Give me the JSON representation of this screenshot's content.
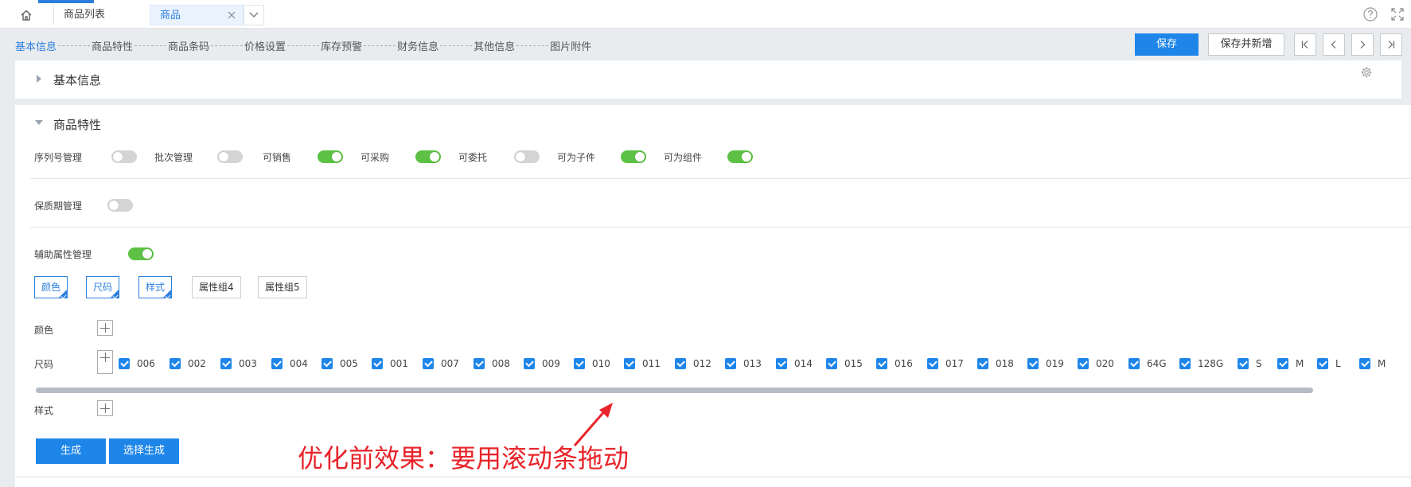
{
  "tabs": {
    "list_label": "商品列表",
    "active_label": "商品"
  },
  "steps": [
    "基本信息",
    "商品特性",
    "商品条码",
    "价格设置",
    "库存预警",
    "财务信息",
    "其他信息",
    "图片附件"
  ],
  "toolbar": {
    "save_label": "保存",
    "save_new_label": "保存并新增"
  },
  "sections": {
    "basic_title": "基本信息",
    "prop_title": "商品特性"
  },
  "switches": [
    {
      "label": "序列号管理",
      "on": false
    },
    {
      "label": "批次管理",
      "on": false
    },
    {
      "label": "可销售",
      "on": true
    },
    {
      "label": "可采购",
      "on": true
    },
    {
      "label": "可委托",
      "on": false
    },
    {
      "label": "可为子件",
      "on": true
    },
    {
      "label": "可为组件",
      "on": true
    }
  ],
  "shelf_life": {
    "label": "保质期管理",
    "on": false
  },
  "aux_attr": {
    "label": "辅助属性管理",
    "on": true
  },
  "attr_groups": [
    {
      "label": "颜色",
      "selected": true
    },
    {
      "label": "尺码",
      "selected": true
    },
    {
      "label": "样式",
      "selected": true
    },
    {
      "label": "属性组4",
      "selected": false
    },
    {
      "label": "属性组5",
      "selected": false
    }
  ],
  "attr_rows": {
    "color_label": "颜色",
    "size_label": "尺码",
    "style_label": "样式"
  },
  "size_values": [
    "006",
    "002",
    "003",
    "004",
    "005",
    "001",
    "007",
    "008",
    "009",
    "010",
    "011",
    "012",
    "013",
    "014",
    "015",
    "016",
    "017",
    "018",
    "019",
    "020",
    "64G",
    "128G",
    "S",
    "M",
    "L",
    "M"
  ],
  "actions": {
    "generate_label": "生成",
    "select_generate_label": "选择生成"
  },
  "annotation": "优化前效果：要用滚动条拖动",
  "colors": {
    "accent": "#1f86e9",
    "toggle_on": "#5cc145",
    "annotation": "#e8242a"
  }
}
